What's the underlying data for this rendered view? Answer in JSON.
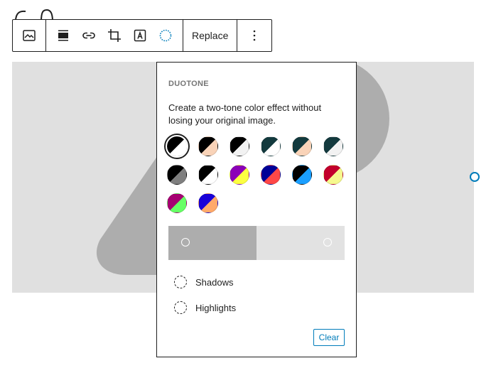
{
  "toolbar": {
    "replace_label": "Replace",
    "icons": [
      "image-icon",
      "align-icon",
      "link-icon",
      "crop-icon",
      "text-overlay-icon",
      "duotone-filter-icon",
      "more-options-icon"
    ]
  },
  "duotone": {
    "title": "DUOTONE",
    "description": "Create a two-tone color effect without losing your original image.",
    "presets": [
      {
        "a": "#000000",
        "b": "#ffffff",
        "selected": true
      },
      {
        "a": "#000000",
        "b": "#f9d3b8"
      },
      {
        "a": "#000000",
        "b": "#f2f2f2"
      },
      {
        "a": "#133a3e",
        "b": "#ffffff"
      },
      {
        "a": "#133a3e",
        "b": "#f9d3b8"
      },
      {
        "a": "#133a3e",
        "b": "#f2f2f2"
      },
      {
        "a": "#000000",
        "b": "#7f7f7f"
      },
      {
        "a": "#000000",
        "b": "#ffffff"
      },
      {
        "a": "#8c00b7",
        "b": "#fcff41"
      },
      {
        "a": "#000097",
        "b": "#ff4747"
      },
      {
        "a": "#000000",
        "b": "#1a9fff"
      },
      {
        "a": "#c3002c",
        "b": "#f6f98e"
      },
      {
        "a": "#a60072",
        "b": "#67ff66"
      },
      {
        "a": "#1900d8",
        "b": "#ffa96b"
      }
    ],
    "shadows_label": "Shadows",
    "highlights_label": "Highlights",
    "clear_label": "Clear",
    "colors": {
      "accent": "#007cba",
      "shadow_swatch": "#adadad",
      "highlight_swatch": "#e2e2e2"
    }
  }
}
